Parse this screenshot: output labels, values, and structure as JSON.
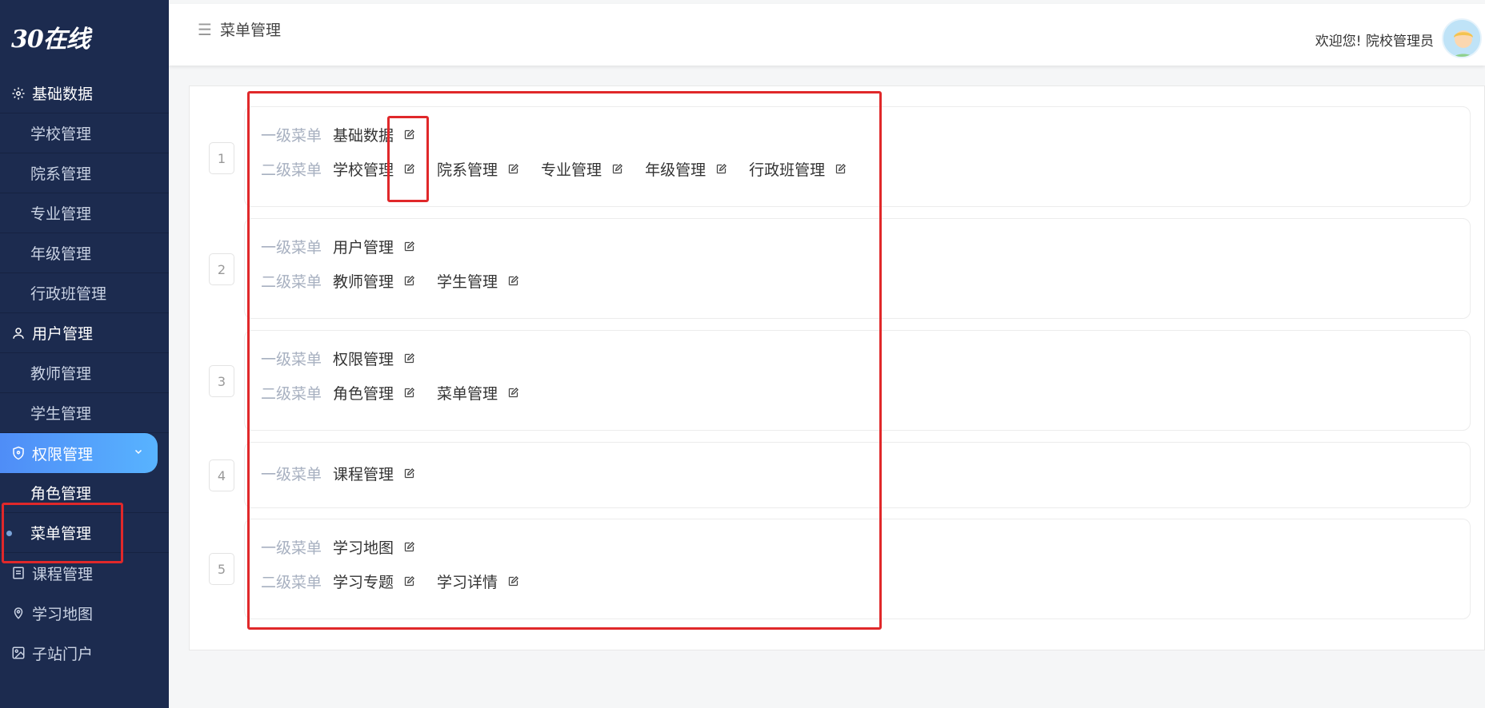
{
  "app": {
    "logo_text": "30在线"
  },
  "sidebar": {
    "groups": [
      {
        "label": "基础数据",
        "icon": "gear-icon",
        "items": [
          "学校管理",
          "院系管理",
          "专业管理",
          "年级管理",
          "行政班管理"
        ]
      },
      {
        "label": "用户管理",
        "icon": "user-icon",
        "items": [
          "教师管理",
          "学生管理"
        ]
      },
      {
        "label": "权限管理",
        "icon": "shield-icon",
        "active": true,
        "items": [
          "角色管理",
          "菜单管理"
        ]
      }
    ],
    "plain": [
      {
        "label": "课程管理",
        "icon": "document-icon"
      },
      {
        "label": "学习地图",
        "icon": "map-icon"
      },
      {
        "label": "子站门户",
        "icon": "image-icon"
      }
    ]
  },
  "header": {
    "breadcrumb": "菜单管理",
    "welcome": "欢迎您!  院校管理员"
  },
  "labels": {
    "level1": "一级菜单",
    "level2": "二级菜单"
  },
  "rows": [
    {
      "index": "1",
      "level1": "基础数据",
      "level2": [
        "学校管理",
        "院系管理",
        "专业管理",
        "年级管理",
        "行政班管理"
      ]
    },
    {
      "index": "2",
      "level1": "用户管理",
      "level2": [
        "教师管理",
        "学生管理"
      ]
    },
    {
      "index": "3",
      "level1": "权限管理",
      "level2": [
        "角色管理",
        "菜单管理"
      ]
    },
    {
      "index": "4",
      "level1": "课程管理",
      "level2": []
    },
    {
      "index": "5",
      "level1": "学习地图",
      "level2": [
        "学习专题",
        "学习详情"
      ]
    }
  ],
  "colors": {
    "sidebar_bg": "#1c2b4f",
    "active_gradient_start": "#4f8df7",
    "annotation_red": "#e0282a"
  }
}
